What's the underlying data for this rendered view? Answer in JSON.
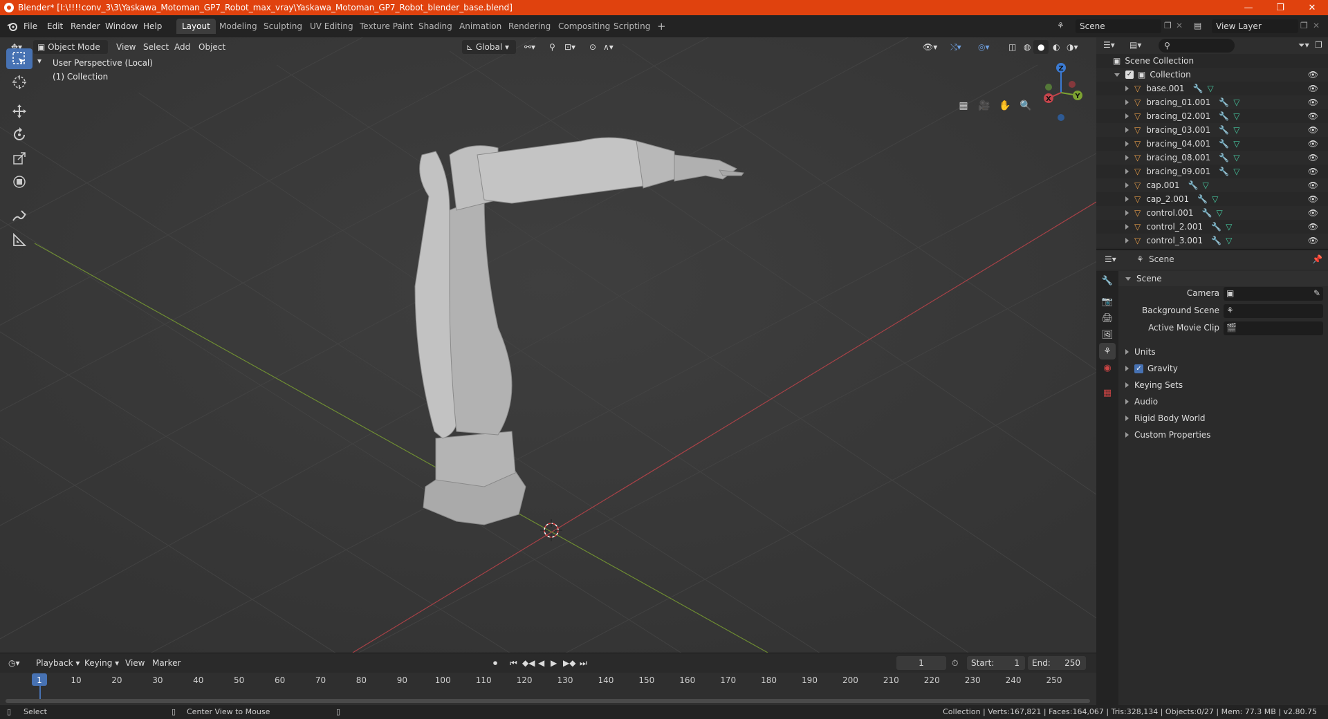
{
  "titlebar": {
    "title": "Blender* [I:\\!!!!conv_3\\3\\Yaskawa_Motoman_GP7_Robot_max_vray\\Yaskawa_Motoman_GP7_Robot_blender_base.blend]",
    "minimize": "—",
    "maximize": "❐",
    "close": "✕"
  },
  "menubar": {
    "menus": [
      "File",
      "Edit",
      "Render",
      "Window",
      "Help"
    ],
    "workspaces": [
      "Layout",
      "Modeling",
      "Sculpting",
      "UV Editing",
      "Texture Paint",
      "Shading",
      "Animation",
      "Rendering",
      "Compositing",
      "Scripting"
    ],
    "add_workspace": "+",
    "scene": "Scene",
    "view_layer": "View Layer"
  },
  "viewport": {
    "mode": "Object Mode",
    "menus": [
      "View",
      "Select",
      "Add",
      "Object"
    ],
    "orientation": "Global",
    "perspective_label": "User Perspective (Local)",
    "collection_label": "(1) Collection",
    "gizmo": {
      "x": "X",
      "y": "Y",
      "z": "Z"
    }
  },
  "timeline": {
    "menus": [
      "Playback",
      "Keying",
      "View",
      "Marker"
    ],
    "current_frame": "1",
    "start_label": "Start:",
    "start": "1",
    "end_label": "End:",
    "end": "250",
    "ticks": [
      "1",
      "10",
      "20",
      "30",
      "40",
      "50",
      "60",
      "70",
      "80",
      "90",
      "100",
      "110",
      "120",
      "130",
      "140",
      "150",
      "160",
      "170",
      "180",
      "190",
      "200",
      "210",
      "220",
      "230",
      "240",
      "250"
    ]
  },
  "statusbar": {
    "select": "Select",
    "center_view": "Center View to Mouse",
    "stats": "Collection | Verts:167,821 | Faces:164,067 | Tris:328,134 | Objects:0/27 | Mem: 77.3 MB | v2.80.75"
  },
  "outliner": {
    "root": "Scene Collection",
    "collection": "Collection",
    "items": [
      "base.001",
      "bracing_01.001",
      "bracing_02.001",
      "bracing_03.001",
      "bracing_04.001",
      "bracing_08.001",
      "bracing_09.001",
      "cap.001",
      "cap_2.001",
      "control.001",
      "control_2.001",
      "control_3.001"
    ]
  },
  "properties": {
    "context": "Scene",
    "panel_title": "Scene",
    "camera_label": "Camera",
    "background_scene_label": "Background Scene",
    "active_clip_label": "Active Movie Clip",
    "sections": [
      "Units",
      "Gravity",
      "Keying Sets",
      "Audio",
      "Rigid Body World",
      "Custom Properties"
    ]
  },
  "colors": {
    "titlebar": "#e0420e",
    "accent": "#4772b3",
    "x_axis": "#c4444b",
    "y_axis": "#7ca231",
    "z_axis": "#3b7bd4"
  }
}
